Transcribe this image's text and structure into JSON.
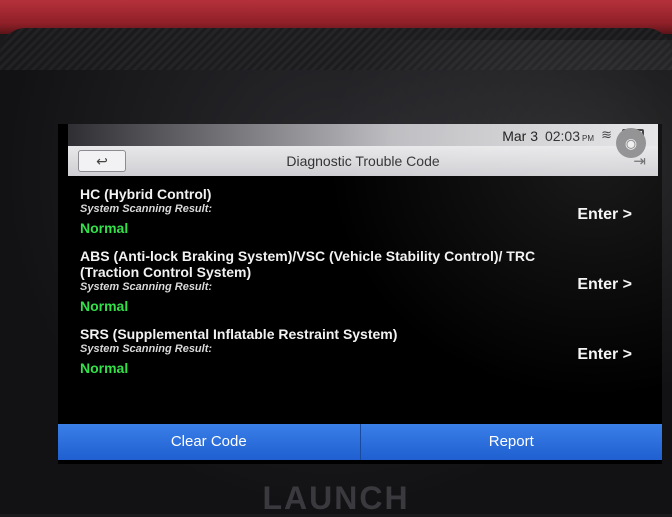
{
  "status": {
    "date": "Mar 3",
    "time": "02:03",
    "ampm": "PM"
  },
  "header": {
    "title": "Diagnostic Trouble Code"
  },
  "systems": [
    {
      "name": "HC (Hybrid Control)",
      "label": "System Scanning Result:",
      "result": "Normal",
      "enter": "Enter >"
    },
    {
      "name": "ABS (Anti-lock Braking System)/VSC (Vehicle Stability Control)/ TRC (Traction Control System)",
      "label": "System Scanning Result:",
      "result": "Normal",
      "enter": "Enter >"
    },
    {
      "name": "SRS (Supplemental Inflatable Restraint System)",
      "label": "System Scanning Result:",
      "result": "Normal",
      "enter": "Enter >"
    }
  ],
  "footer": {
    "clear_label": "Clear Code",
    "report_label": "Report"
  },
  "device": {
    "brand": "LAUNCH"
  },
  "colors": {
    "accent": "#2a6fe0",
    "normal": "#33e04a",
    "case": "#a52a33"
  },
  "icons": [
    "back-arrow-icon",
    "wifi-icon",
    "battery-icon",
    "camera-icon",
    "exit-icon"
  ]
}
